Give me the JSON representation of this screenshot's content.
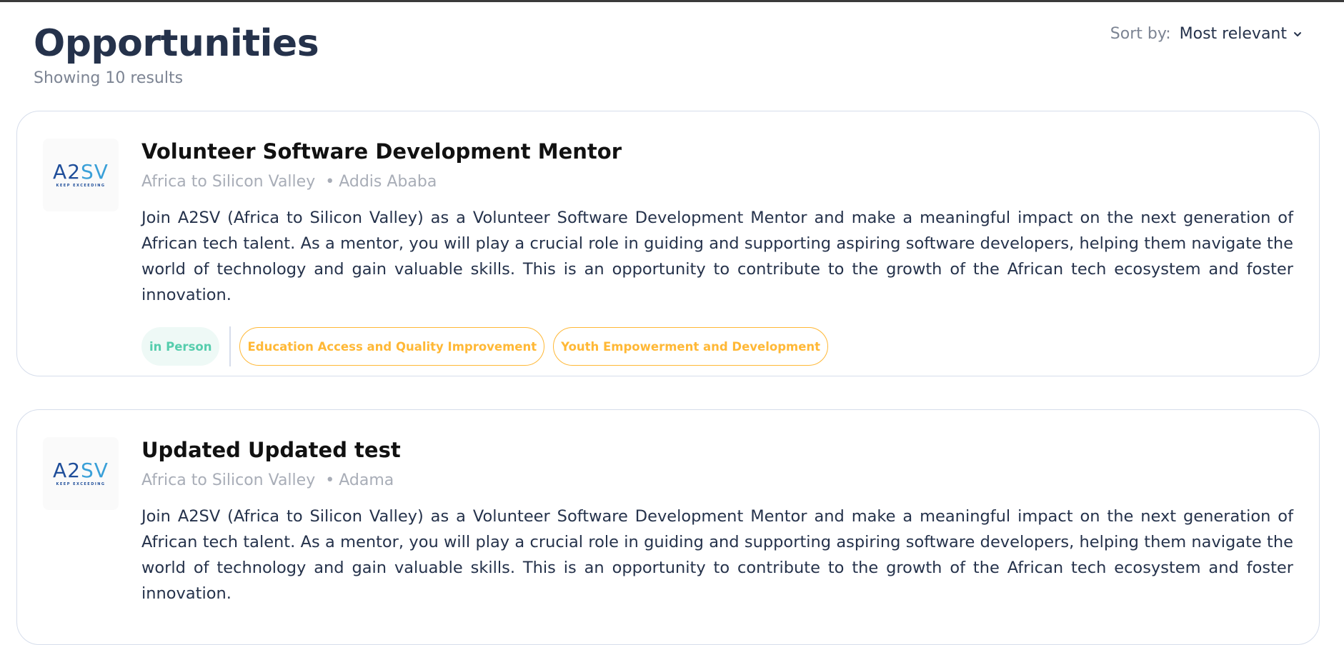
{
  "header": {
    "title": "Opportunities",
    "results_text": "Showing 10 results",
    "sort_label": "Sort by:",
    "sort_value": "Most relevant"
  },
  "cards": [
    {
      "logo": {
        "mark_a": "A",
        "mark_2": "2",
        "mark_sv": "SV",
        "tagline": "KEEP EXCEEDING"
      },
      "title": "Volunteer Software Development Mentor",
      "company": "Africa to Silicon Valley",
      "location": "Addis Ababa",
      "description": "Join A2SV (Africa to Silicon Valley) as a Volunteer Software Development Mentor and make a meaningful impact on the next generation of African tech talent. As a mentor, you will play a crucial role in guiding and supporting aspiring software developers, helping them navigate the world of technology and gain valuable skills. This is an opportunity to contribute to the growth of the African tech ecosystem and foster innovation.",
      "work_type": "in Person",
      "categories": [
        "Education Access and Quality Improvement",
        "Youth Empowerment and Development"
      ]
    },
    {
      "logo": {
        "mark_a": "A",
        "mark_2": "2",
        "mark_sv": "SV",
        "tagline": "KEEP EXCEEDING"
      },
      "title": "Updated Updated test",
      "company": "Africa to Silicon Valley",
      "location": "Adama",
      "description": "Join A2SV (Africa to Silicon Valley) as a Volunteer Software Development Mentor and make a meaningful impact on the next generation of African tech talent. As a mentor, you will play a crucial role in guiding and supporting aspiring software developers, helping them navigate the world of technology and gain valuable skills. This is an opportunity to contribute to the growth of the African tech ecosystem and foster innovation."
    }
  ],
  "colors": {
    "title": "#25324B",
    "muted": "#7C8493",
    "tag_green": "#56CDAD",
    "tag_orange": "#FFB836",
    "border": "#D6DDEB"
  },
  "icons": {
    "sort_chevron": "chevron-down-icon",
    "meta_separator": "•"
  }
}
